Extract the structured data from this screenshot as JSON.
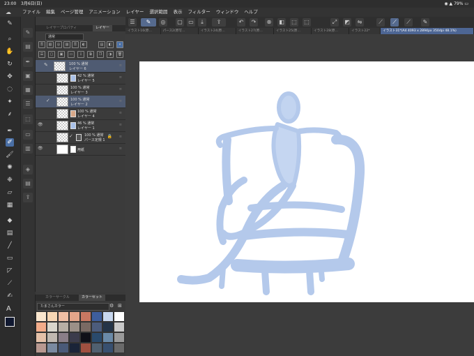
{
  "status": {
    "time": "23:00",
    "date": "3月6日(日)",
    "battery": "79%"
  },
  "menu": {
    "items": [
      "ファイル",
      "編集",
      "ページ管理",
      "アニメーション",
      "レイヤー",
      "選択範囲",
      "表示",
      "フィルター",
      "ウィンドウ",
      "ヘルプ"
    ]
  },
  "tabs": [
    "イラスト16(原…",
    "パース2(原写…",
    "イラスト24(原…",
    "イラスト27(原…",
    "イラスト25(原…",
    "イラスト28(原…",
    "イラスト22*",
    "イラスト31*(A4 4093 x 2894px 350dpi 48.1%)"
  ],
  "layer_panel": {
    "tab_property": "レイヤープロパティ",
    "tab_layer": "レイヤー",
    "blend": "通常",
    "layers": [
      {
        "opacity": "100 %  通常",
        "name": "レイヤー 6",
        "selected": true
      },
      {
        "opacity": "42 %  通常",
        "name": "レイヤー 5",
        "selected": false
      },
      {
        "opacity": "100 %  通常",
        "name": "レイヤー 3",
        "selected": false
      },
      {
        "opacity": "100 %  通常",
        "name": "レイヤー 2",
        "selected": true
      },
      {
        "opacity": "100 %  通常",
        "name": "レイヤー 4",
        "selected": false
      },
      {
        "opacity": "46 %  通常",
        "name": "レイヤー 1",
        "selected": false
      },
      {
        "opacity": "100 %  通常",
        "name": "パース定規 1",
        "selected": false
      },
      {
        "opacity": "",
        "name": "用紙",
        "selected": false
      }
    ]
  },
  "color_panel": {
    "tab_wheel": "カラーサークル",
    "tab_set": "カラーセット",
    "set_name": "たまさんカラー",
    "swatches": [
      "#fbe7cf",
      "#f7d7b5",
      "#efbfa5",
      "#e3a58a",
      "#c97862",
      "#3e5e9c",
      "#c8d8ef",
      "#ffffff",
      "#f2ac8a",
      "#d9d6cc",
      "#b7afa5",
      "#9b9088",
      "#7a6a64",
      "#4c5c7c",
      "#243448",
      "#c9c9c9",
      "#e4c0a8",
      "#c0b8b0",
      "#8a7e88",
      "#3c3c4c",
      "#101018",
      "#2a4a6c",
      "#6a8aa8",
      "#9a9a9a",
      "#b89890",
      "#7a8aa0",
      "#4a5a78",
      "#1a2438",
      "#a05040",
      "#506070",
      "#385070",
      "#6a6a6a"
    ]
  },
  "colors": {
    "accent": "#4a6fa5",
    "sketch": "#a8c0e8",
    "foreground": "#101830"
  }
}
